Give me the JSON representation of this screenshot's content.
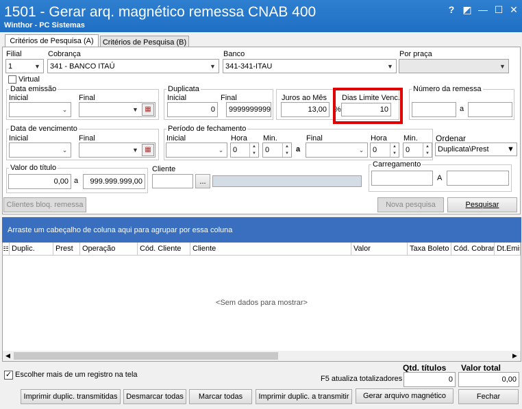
{
  "window": {
    "title": "1501 - Gerar arq. magnético remessa CNAB 400",
    "subtitle": "Winthor - PC Sistemas",
    "help": "?",
    "restore": "◩",
    "minimize": "—",
    "maximize": "☐",
    "close": "✕"
  },
  "tabs": [
    "Critérios de Pesquisa (A)",
    "Critérios de Pesquisa (B)"
  ],
  "form": {
    "filial_label": "Filial",
    "filial_value": "1",
    "cobranca_label": "Cobrança",
    "cobranca_value": "341 - BANCO ITAÚ",
    "banco_label": "Banco",
    "banco_value": "341-341-ITAU",
    "porpraca_label": "Por praça",
    "porpraca_value": "",
    "virtual_label": "Virtual",
    "data_emissao_label": "Data emissão",
    "inicial_label": "Inicial",
    "final_label": "Final",
    "duplicata_label": "Duplicata",
    "dup_inicial": "0",
    "dup_final": "9999999999",
    "juros_label": "Juros ao Mês",
    "juros_value": "13,00",
    "pct": "%",
    "dias_label": "Dias Limite Venc.",
    "dias_value": "10",
    "num_remessa_label": "Número da remessa",
    "a_label": "a",
    "A_label": "A",
    "data_venc_label": "Data de vencimento",
    "periodo_label": "Período de fechamento",
    "hora_label": "Hora",
    "min_label": "Min.",
    "hora1": "0",
    "min1": "0",
    "hora2": "0",
    "min2": "0",
    "ordenar_label": "Ordenar",
    "ordenar_value": "Duplicata\\Prest",
    "valor_titulo_label": "Valor do título",
    "valor_ini": "0,00",
    "valor_fim": "999.999.999,00",
    "cliente_label": "Cliente",
    "cliente_btn": "...",
    "carregamento_label": "Carregamento"
  },
  "buttons": {
    "clientes_bloq": "Clientes bloq. remessa",
    "nova_pesquisa": "Nova pesquisa",
    "pesquisar": "Pesquisar",
    "imprimir_transmitidas": "Imprimir duplic. transmitidas",
    "desmarcar": "Desmarcar todas",
    "marcar": "Marcar todas",
    "imprimir_transmitir": "Imprimir duplic. a transmitir",
    "gerar": "Gerar arquivo magnético",
    "fechar": "Fechar"
  },
  "grid": {
    "group_hint": "Arraste um cabeçalho de coluna aqui para agrupar por essa coluna",
    "columns": [
      "Duplic.",
      "Prest",
      "Operação",
      "Cód. Cliente",
      "Cliente",
      "Valor",
      "Taxa Boleto",
      "Cód. Cobran",
      "Dt.Emis"
    ],
    "empty": "<Sem dados para mostrar>"
  },
  "footer": {
    "escolher_label": "Escolher mais de um registro na tela",
    "f5_label": "F5 atualiza totalizadores",
    "qtd_label": "Qtd. títulos",
    "qtd_value": "0",
    "valor_total_label": "Valor total",
    "valor_total_value": "0,00"
  },
  "colors": {
    "titlebar": "#1e6ec4",
    "group_panel": "#3a6fc0",
    "highlight": "#e00000"
  }
}
